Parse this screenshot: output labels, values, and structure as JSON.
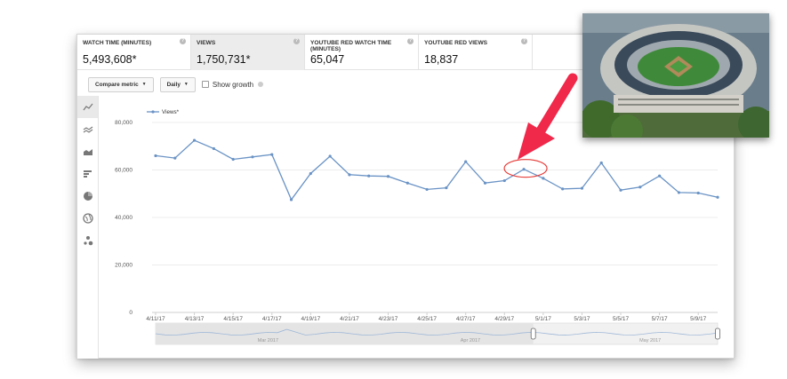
{
  "metrics": [
    {
      "label": "WATCH TIME (MINUTES)",
      "value": "5,493,608*",
      "active": false
    },
    {
      "label": "VIEWS",
      "value": "1,750,731*",
      "active": true
    },
    {
      "label": "YOUTUBE RED WATCH TIME (MINUTES)",
      "value": "65,047",
      "active": false
    },
    {
      "label": "YOUTUBE RED VIEWS",
      "value": "18,837",
      "active": false
    }
  ],
  "help_glyph": "?",
  "controls": {
    "compare_metric": "Compare metric",
    "interval": "Daily",
    "show_growth": "Show growth"
  },
  "toolbar_icons": [
    "line-chart-icon",
    "multi-line-icon",
    "area-chart-icon",
    "bar-chart-icon",
    "pie-chart-icon",
    "globe-map-icon",
    "bubble-chart-icon"
  ],
  "colors": {
    "series": "#6a93c5",
    "annotation_arrow": "#f0284a",
    "annotation_circle": "#e53935",
    "active_tab": "#ececec"
  },
  "chart_data": {
    "type": "line",
    "legend": "Views*",
    "legend_position": "top-left",
    "y_ticks": [
      "0",
      "20,000",
      "40,000",
      "60,000",
      "80,000"
    ],
    "ylim": [
      0,
      80000
    ],
    "grid": true,
    "x_tick_labels": [
      "4/11/17",
      "4/13/17",
      "4/15/17",
      "4/17/17",
      "4/19/17",
      "4/21/17",
      "4/23/17",
      "4/25/17",
      "4/27/17",
      "4/29/17",
      "5/1/17",
      "5/3/17",
      "5/5/17",
      "5/7/17",
      "5/9/17"
    ],
    "series": [
      {
        "name": "Views*",
        "x": [
          "4/11/17",
          "4/12/17",
          "4/13/17",
          "4/14/17",
          "4/15/17",
          "4/16/17",
          "4/17/17",
          "4/18/17",
          "4/19/17",
          "4/20/17",
          "4/21/17",
          "4/22/17",
          "4/23/17",
          "4/24/17",
          "4/25/17",
          "4/26/17",
          "4/27/17",
          "4/28/17",
          "4/29/17",
          "4/30/17",
          "5/1/17",
          "5/2/17",
          "5/3/17",
          "5/4/17",
          "5/5/17",
          "5/6/17",
          "5/7/17",
          "5/8/17",
          "5/9/17",
          "5/10/17"
        ],
        "values": [
          66000,
          65000,
          72500,
          69000,
          64500,
          65500,
          66500,
          47500,
          58500,
          65800,
          58000,
          57500,
          57300,
          54500,
          51800,
          52500,
          63500,
          54500,
          55500,
          60300,
          56500,
          52000,
          52300,
          63000,
          51500,
          52800,
          57500,
          50500,
          50300,
          48500
        ]
      }
    ],
    "navigator": {
      "month_labels": [
        "Mar 2017",
        "Apr 2017",
        "May 2017"
      ]
    }
  }
}
